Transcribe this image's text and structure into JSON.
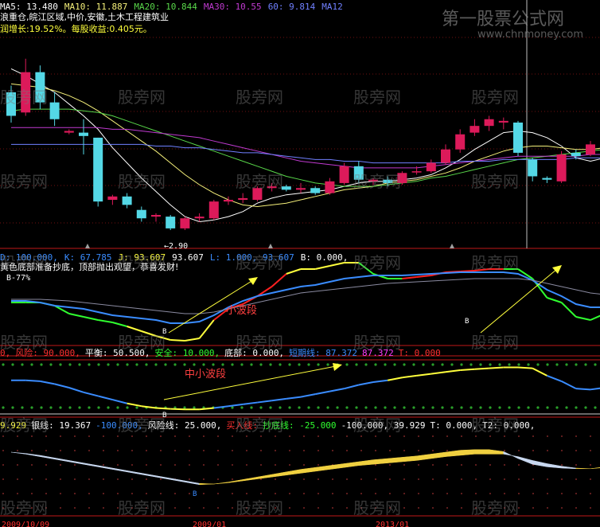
{
  "colors": {
    "up": "#dc1a5a",
    "down": "#54d8e6",
    "ma5": "#ffffff",
    "ma10": "#f5f07a",
    "ma20": "#59d84a",
    "ma30": "#c03ad0",
    "ma60": "#7080ff",
    "yellow": "#ffff3c",
    "red": "#ff2020",
    "green": "#30ff30",
    "blue": "#3a8cff"
  },
  "header": {
    "ma_line": [
      {
        "text": "MA5: 13.480",
        "color": "#ffffff"
      },
      {
        "text": "MA10: 11.887",
        "color": "#f5f07a"
      },
      {
        "text": "MA20: 10.844",
        "color": "#59d84a"
      },
      {
        "text": "MA30: 10.55",
        "color": "#c03ad0"
      },
      {
        "text": "60: 9.814",
        "color": "#7080ff"
      },
      {
        "text": "MA12",
        "color": "#7080ff"
      }
    ],
    "info": "浪重仓,皖江区域,中价,安徽,土木工程建筑业",
    "growth": "润增长:19.52%。每股收益:0.405元。"
  },
  "watermark": "股旁网",
  "brand": {
    "title": "第一股票公式网",
    "url": "www.chnmoney.com"
  },
  "price": {
    "low_marker": "2.90"
  },
  "kdj": {
    "labels": [
      {
        "text": "D: 100.000,",
        "color": "#3a8cff"
      },
      {
        "text": "K: 67.785",
        "color": "#3a8cff"
      },
      {
        "text": "J: 93.607",
        "color": "#ffff3c"
      },
      {
        "text": "93.607",
        "color": "#ffffff"
      },
      {
        "text": "L: 1.000, 93.607",
        "color": "#3a8cff"
      },
      {
        "text": "B: 0.000,",
        "color": "#ffffff"
      }
    ],
    "subtitle": "黄色底部准备抄底，顶部抛出观望，恭喜发财!",
    "line2": "B-77%",
    "annotation": "小波段",
    "b_label": "B"
  },
  "osc": {
    "labels": [
      {
        "text": "0,",
        "color": "#ff3030"
      },
      {
        "text": "风险: 90.000,",
        "color": "#ff3030"
      },
      {
        "text": "平衡: 50.500,",
        "color": "#ffffff"
      },
      {
        "text": "安全: 10.000,",
        "color": "#30ff30"
      },
      {
        "text": "底部: 0.000,",
        "color": "#ffffff"
      },
      {
        "text": "短期线: 87.372",
        "color": "#3a8cff"
      },
      {
        "text": "87.372",
        "color": "#ff3cff"
      },
      {
        "text": "T: 0.000",
        "color": "#ff3030"
      }
    ],
    "annotation": "中小波段",
    "b_label": "B"
  },
  "bottom": {
    "labels": [
      {
        "text": "9.929",
        "color": "#ffff3c"
      },
      {
        "text": "银线: 19.367",
        "color": "#ffffff"
      },
      {
        "text": "-100.000,",
        "color": "#3a8cff"
      },
      {
        "text": "风险线: 25.000,",
        "color": "#ffffff"
      },
      {
        "text": "买入线:",
        "color": "#ff3030"
      },
      {
        "text": "抄底线: -25.000",
        "color": "#30ff30"
      },
      {
        "text": "-100.000, 39.929",
        "color": "#ffffff"
      },
      {
        "text": "T: 0.000,",
        "color": "#ffffff"
      },
      {
        "text": "T2: 0.000,",
        "color": "#ffffff"
      }
    ],
    "b_label": "B"
  },
  "date_axis": [
    "2009/10/09",
    "2009/01",
    "2013/01"
  ],
  "chart_data": [
    {
      "type": "candlestick",
      "title": "",
      "candles": [
        {
          "o": 12.0,
          "h": 12.4,
          "l": 10.2,
          "c": 10.6
        },
        {
          "o": 10.8,
          "h": 14.0,
          "l": 10.6,
          "c": 13.2
        },
        {
          "o": 13.2,
          "h": 13.6,
          "l": 11.0,
          "c": 11.4
        },
        {
          "o": 11.4,
          "h": 12.0,
          "l": 10.0,
          "c": 10.4
        },
        {
          "o": 9.6,
          "h": 9.8,
          "l": 9.5,
          "c": 9.7
        },
        {
          "o": 9.6,
          "h": 10.4,
          "l": 8.3,
          "c": 9.4
        },
        {
          "o": 9.3,
          "h": 9.3,
          "l": 5.2,
          "c": 5.5
        },
        {
          "o": 5.6,
          "h": 5.9,
          "l": 5.3,
          "c": 5.8
        },
        {
          "o": 5.8,
          "h": 6.0,
          "l": 5.1,
          "c": 5.3
        },
        {
          "o": 5.0,
          "h": 5.2,
          "l": 4.3,
          "c": 4.5
        },
        {
          "o": 4.6,
          "h": 4.8,
          "l": 4.3,
          "c": 4.7
        },
        {
          "o": 4.6,
          "h": 4.7,
          "l": 3.8,
          "c": 3.9
        },
        {
          "o": 3.9,
          "h": 4.6,
          "l": 3.8,
          "c": 4.5
        },
        {
          "o": 4.5,
          "h": 4.8,
          "l": 4.3,
          "c": 4.6
        },
        {
          "o": 4.5,
          "h": 5.6,
          "l": 4.4,
          "c": 5.5
        },
        {
          "o": 5.5,
          "h": 5.8,
          "l": 5.3,
          "c": 5.6
        },
        {
          "o": 5.6,
          "h": 6.0,
          "l": 5.4,
          "c": 5.7
        },
        {
          "o": 5.6,
          "h": 6.4,
          "l": 5.5,
          "c": 6.3
        },
        {
          "o": 6.3,
          "h": 6.6,
          "l": 6.1,
          "c": 6.4
        },
        {
          "o": 6.4,
          "h": 6.5,
          "l": 6.1,
          "c": 6.2
        },
        {
          "o": 6.2,
          "h": 6.6,
          "l": 6.0,
          "c": 6.3
        },
        {
          "o": 6.3,
          "h": 6.4,
          "l": 5.9,
          "c": 6.0
        },
        {
          "o": 6.0,
          "h": 6.9,
          "l": 5.9,
          "c": 6.7
        },
        {
          "o": 6.6,
          "h": 7.8,
          "l": 6.5,
          "c": 7.6
        },
        {
          "o": 7.6,
          "h": 7.9,
          "l": 6.6,
          "c": 6.8
        },
        {
          "o": 6.7,
          "h": 6.9,
          "l": 6.5,
          "c": 6.8
        },
        {
          "o": 6.8,
          "h": 7.0,
          "l": 6.4,
          "c": 6.6
        },
        {
          "o": 6.6,
          "h": 7.3,
          "l": 6.5,
          "c": 7.2
        },
        {
          "o": 7.3,
          "h": 7.6,
          "l": 7.1,
          "c": 7.3
        },
        {
          "o": 7.3,
          "h": 8.0,
          "l": 7.2,
          "c": 7.8
        },
        {
          "o": 7.8,
          "h": 8.9,
          "l": 7.7,
          "c": 8.6
        },
        {
          "o": 8.6,
          "h": 9.8,
          "l": 8.4,
          "c": 9.5
        },
        {
          "o": 9.6,
          "h": 10.4,
          "l": 9.4,
          "c": 10.0
        },
        {
          "o": 10.0,
          "h": 10.6,
          "l": 9.7,
          "c": 10.4
        },
        {
          "o": 10.2,
          "h": 10.5,
          "l": 9.8,
          "c": 10.3
        },
        {
          "o": 10.2,
          "h": 10.3,
          "l": 8.2,
          "c": 8.4
        },
        {
          "o": 8.0,
          "h": 8.1,
          "l": 6.7,
          "c": 7.0
        },
        {
          "o": 6.9,
          "h": 7.0,
          "l": 6.6,
          "c": 6.8
        },
        {
          "o": 6.7,
          "h": 8.5,
          "l": 6.6,
          "c": 8.3
        },
        {
          "o": 8.4,
          "h": 8.6,
          "l": 8.0,
          "c": 8.2
        },
        {
          "o": 8.3,
          "h": 9.1,
          "l": 8.2,
          "c": 8.9
        },
        {
          "o": 8.9,
          "h": 9.2,
          "l": 8.7,
          "c": 9.0
        },
        {
          "o": 9.0,
          "h": 9.7,
          "l": 8.9,
          "c": 9.4
        },
        {
          "o": 9.4,
          "h": 10.9,
          "l": 9.2,
          "c": 10.6
        },
        {
          "o": 10.6,
          "h": 11.0,
          "l": 10.4,
          "c": 10.7
        },
        {
          "o": 10.7,
          "h": 15.5,
          "l": 10.5,
          "c": 15.0
        }
      ],
      "ylim": [
        2.9,
        15.6
      ],
      "ma_series": [
        {
          "name": "MA5",
          "color": "#ffffff",
          "y": [
            13.4,
            13.0,
            12.5,
            12.0,
            11.3,
            10.6,
            9.8,
            8.7,
            7.8,
            6.9,
            6.1,
            5.3,
            4.6,
            4.3,
            4.4,
            4.6,
            4.9,
            5.4,
            5.7,
            5.9,
            6.0,
            6.1,
            6.2,
            6.4,
            6.6,
            6.7,
            6.7,
            6.8,
            6.9,
            7.1,
            7.5,
            8.0,
            8.6,
            9.1,
            9.6,
            9.7,
            9.6,
            9.3,
            8.8,
            8.1,
            7.9,
            8.1,
            8.5,
            9.0,
            9.5,
            10.3
          ]
        },
        {
          "name": "MA10",
          "color": "#f5f07a",
          "y": [
            12.5,
            12.4,
            12.3,
            12.1,
            11.8,
            11.4,
            10.9,
            10.3,
            9.7,
            9.1,
            8.5,
            7.8,
            7.1,
            6.5,
            6.0,
            5.6,
            5.3,
            5.2,
            5.3,
            5.4,
            5.6,
            5.8,
            6.0,
            6.2,
            6.3,
            6.4,
            6.6,
            6.7,
            6.8,
            7.0,
            7.2,
            7.5,
            7.9,
            8.2,
            8.5,
            8.7,
            8.8,
            8.8,
            8.7,
            8.6,
            8.6,
            8.7,
            8.8,
            9.0,
            9.2,
            9.6
          ]
        },
        {
          "name": "MA20",
          "color": "#59d84a",
          "y": [
            10.9,
            11.0,
            11.0,
            11.0,
            11.0,
            10.9,
            10.8,
            10.6,
            10.3,
            10.0,
            9.7,
            9.4,
            9.1,
            8.8,
            8.5,
            8.2,
            7.9,
            7.6,
            7.3,
            7.0,
            6.8,
            6.6,
            6.5,
            6.4,
            6.4,
            6.4,
            6.5,
            6.6,
            6.7,
            6.9,
            7.0,
            7.2,
            7.4,
            7.6,
            7.8,
            8.0,
            8.1,
            8.2,
            8.3,
            8.4,
            8.5,
            8.6,
            8.7,
            8.9,
            9.2,
            9.6
          ]
        },
        {
          "name": "MA30",
          "color": "#c03ad0",
          "y": [
            9.9,
            9.9,
            9.9,
            9.9,
            9.9,
            9.9,
            9.9,
            9.8,
            9.8,
            9.7,
            9.6,
            9.5,
            9.4,
            9.3,
            9.1,
            8.9,
            8.7,
            8.5,
            8.3,
            8.1,
            7.9,
            7.8,
            7.7,
            7.6,
            7.5,
            7.5,
            7.5,
            7.5,
            7.5,
            7.6,
            7.7,
            7.8,
            7.9,
            8.0,
            8.1,
            8.2,
            8.2,
            8.2,
            8.2,
            8.2,
            8.3,
            8.3,
            8.4,
            8.5,
            8.6,
            8.7
          ]
        },
        {
          "name": "MA60",
          "color": "#7080ff",
          "y": [
            8.9,
            8.9,
            8.9,
            8.9,
            8.9,
            8.9,
            8.9,
            8.9,
            8.9,
            8.9,
            8.8,
            8.8,
            8.7,
            8.7,
            8.6,
            8.5,
            8.4,
            8.4,
            8.3,
            8.2,
            8.1,
            8.0,
            8.0,
            7.9,
            7.9,
            7.8,
            7.8,
            7.8,
            7.8,
            7.8,
            7.8,
            7.9,
            7.9,
            7.9,
            8.0,
            8.0,
            8.0,
            8.0,
            8.0,
            8.1,
            8.1,
            8.1,
            8.1,
            8.2,
            8.2,
            8.3
          ]
        }
      ]
    },
    {
      "type": "line",
      "title": "",
      "ylim": [
        0,
        100
      ],
      "series": [
        {
          "name": "J",
          "colors_by_segment": "green/red/yellow",
          "y": [
            50,
            50,
            50,
            46,
            36,
            32,
            28,
            25,
            20,
            14,
            8,
            3,
            2,
            5,
            28,
            42,
            48,
            58,
            70,
            86,
            92,
            92,
            96,
            100,
            100,
            86,
            80,
            80,
            82,
            84,
            88,
            89,
            90,
            92,
            92,
            92,
            80,
            56,
            50,
            32,
            28,
            36,
            52,
            62,
            70,
            82,
            95
          ]
        },
        {
          "name": "K",
          "color": "#3a8cff",
          "y": [
            52,
            52,
            50,
            46,
            44,
            42,
            38,
            34,
            32,
            30,
            28,
            24,
            24,
            26,
            34,
            44,
            52,
            58,
            62,
            66,
            70,
            72,
            76,
            80,
            82,
            84,
            84,
            84,
            85,
            86,
            87,
            88,
            88,
            88,
            88,
            86,
            78,
            66,
            58,
            48,
            44,
            44,
            50,
            58,
            64,
            70,
            72
          ]
        },
        {
          "name": "D",
          "color": "#8a8aa0",
          "y": [
            54,
            54,
            54,
            53,
            52,
            50,
            48,
            46,
            44,
            42,
            40,
            38,
            36,
            36,
            38,
            42,
            46,
            50,
            54,
            58,
            62,
            64,
            66,
            68,
            70,
            72,
            74,
            75,
            76,
            77,
            78,
            79,
            80,
            80,
            80,
            80,
            78,
            74,
            70,
            66,
            62,
            60,
            60,
            62,
            64,
            66,
            68
          ]
        }
      ]
    },
    {
      "type": "line",
      "title": "",
      "ylim": [
        0,
        100
      ],
      "series": [
        {
          "name": "短期线",
          "y": [
            66,
            66,
            64,
            58,
            50,
            40,
            32,
            24,
            16,
            10,
            6,
            4,
            3,
            3,
            6,
            10,
            14,
            18,
            22,
            26,
            30,
            36,
            42,
            48,
            56,
            62,
            66,
            72,
            76,
            80,
            84,
            88,
            90,
            92,
            94,
            94,
            92,
            76,
            64,
            48,
            46,
            50,
            58,
            68,
            76,
            82,
            88
          ]
        }
      ]
    },
    {
      "type": "area",
      "title": "",
      "ylim": [
        -100,
        100
      ],
      "series": [
        {
          "name": "银线",
          "y": [
            50,
            46,
            40,
            32,
            24,
            16,
            8,
            0,
            -8,
            -16,
            -24,
            -32,
            -40,
            -48,
            -50,
            -46,
            -40,
            -34,
            -28,
            -22,
            -16,
            -10,
            -4,
            2,
            8,
            12,
            16,
            20,
            24,
            30,
            36,
            40,
            44,
            44,
            44,
            36,
            24,
            14,
            6,
            0,
            -2,
            2,
            6,
            12,
            18,
            28
          ]
        },
        {
          "name": "金线",
          "y": [
            50,
            44,
            36,
            28,
            20,
            12,
            4,
            -4,
            -12,
            -20,
            -28,
            -36,
            -44,
            -52,
            -50,
            -44,
            -36,
            -28,
            -20,
            -12,
            -4,
            2,
            8,
            14,
            20,
            26,
            30,
            34,
            38,
            44,
            50,
            56,
            58,
            58,
            52,
            30,
            12,
            4,
            0,
            -2,
            -2,
            4,
            12,
            22,
            34,
            50
          ]
        }
      ]
    }
  ]
}
